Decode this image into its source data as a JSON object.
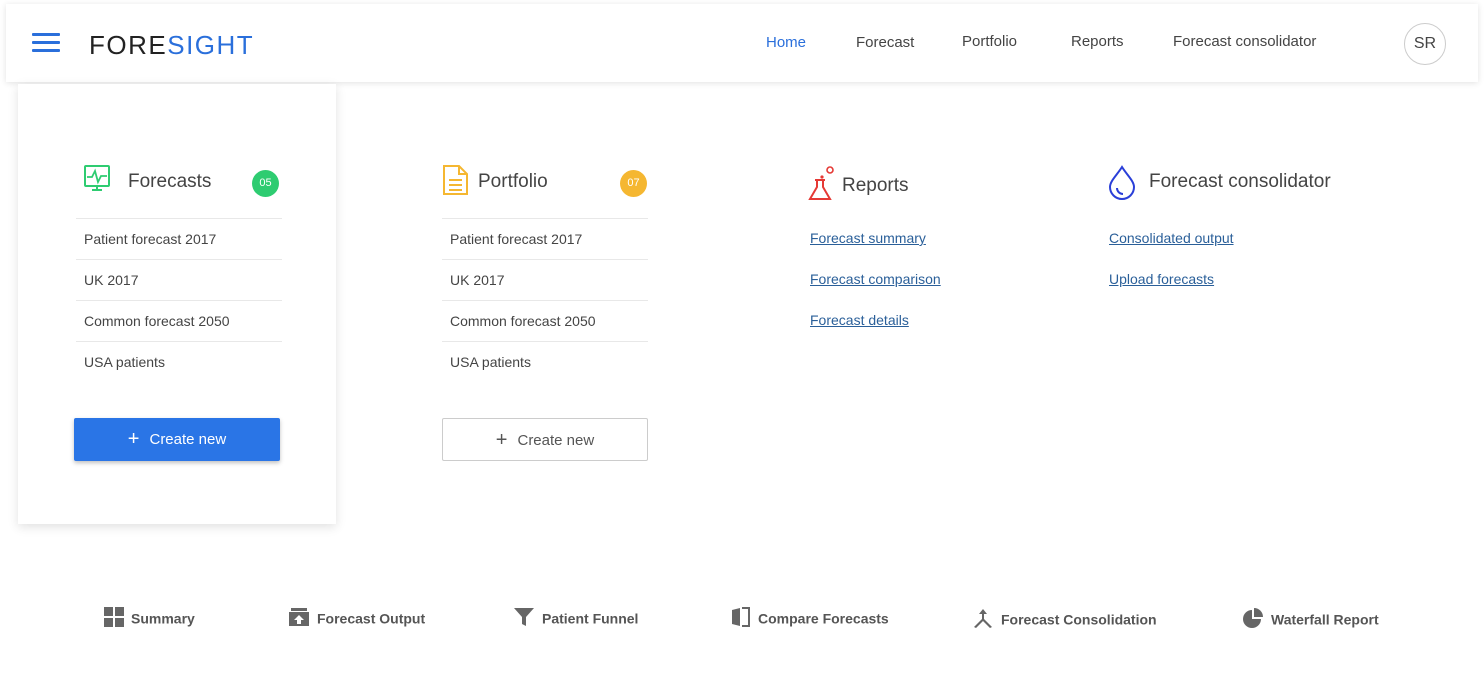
{
  "header": {
    "logo_part1": "FORE",
    "logo_part2": "SIGHT",
    "nav": [
      "Home",
      "Forecast",
      "Portfolio",
      "Reports",
      "Forecast consolidator"
    ],
    "avatar_initials": "SR"
  },
  "forecasts": {
    "title": "Forecasts",
    "badge": "05",
    "items": [
      "Patient forecast 2017",
      "UK 2017",
      "Common forecast 2050",
      "USA patients"
    ],
    "button": "Create new",
    "icon": "monitor-pulse-icon",
    "color": "#2ecc71"
  },
  "portfolio": {
    "title": "Portfolio",
    "badge": "07",
    "items": [
      "Patient forecast 2017",
      "UK 2017",
      "Common forecast 2050",
      "USA patients"
    ],
    "button": "Create new",
    "icon": "document-icon",
    "color": "#f5b731"
  },
  "reports": {
    "title": "Reports",
    "links": [
      "Forecast summary",
      "Forecast comparison",
      "Forecast details"
    ],
    "icon": "flask-icon",
    "color": "#e53935"
  },
  "consolidator": {
    "title": "Forecast consolidator",
    "links": [
      "Consolidated output",
      "Upload forecasts"
    ],
    "icon": "drop-icon",
    "color": "#2a3fd8"
  },
  "toolbar": [
    "Summary",
    "Forecast Output",
    "Patient Funnel",
    "Compare Forecasts",
    "Forecast Consolidation",
    "Waterfall Report"
  ],
  "colors": {
    "accent": "#2a6fdb",
    "primary_button": "#2a75e6"
  }
}
